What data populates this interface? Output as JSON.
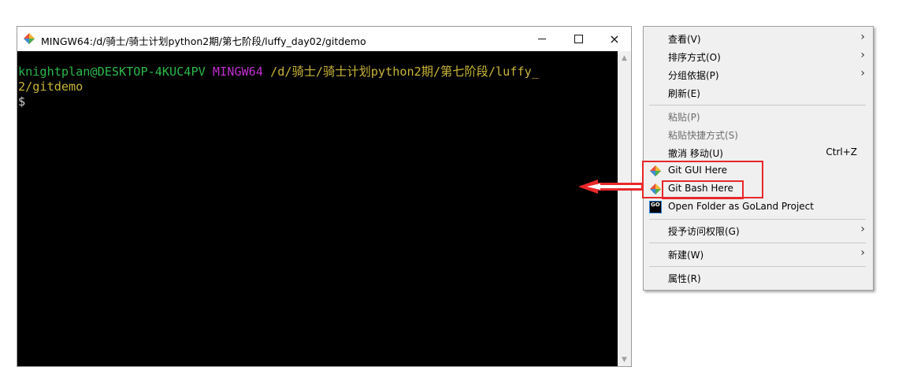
{
  "terminal": {
    "title": "MINGW64:/d/骑士/骑士计划python2期/第七阶段/luffy_day02/gitdemo",
    "controls": {
      "minimize": "minimize",
      "maximize": "maximize",
      "close": "×"
    },
    "lines": {
      "user_host": "knightplan@DESKTOP-4KUC4PV",
      "env": "MINGW64",
      "path_part1": "/d/骑士/骑士计划python2期/第七阶段/luffy_",
      "path_part2": "2/gitdemo",
      "prompt": "$"
    },
    "colors": {
      "user_host": "#2bb84b",
      "env": "#c02ed1",
      "path": "#c9b538",
      "prompt": "#d0d0d0"
    }
  },
  "context_menu": {
    "items": [
      {
        "label": "查看(V)",
        "submenu": true
      },
      {
        "label": "排序方式(O)",
        "submenu": true
      },
      {
        "label": "分组依据(P)",
        "submenu": true
      },
      {
        "label": "刷新(E)"
      },
      {
        "label": "粘贴(P)",
        "disabled": true
      },
      {
        "label": "粘贴快捷方式(S)",
        "disabled": true
      },
      {
        "label": "撤消 移动(U)",
        "shortcut": "Ctrl+Z"
      },
      {
        "label": "Git GUI Here",
        "icon": "git-icon"
      },
      {
        "label": "Git Bash Here",
        "icon": "git-icon"
      },
      {
        "label": "Open Folder as GoLand Project",
        "icon": "goland-icon",
        "icon_text": "GO"
      },
      {
        "label": "授予访问权限(G)",
        "submenu": true
      },
      {
        "label": "新建(W)",
        "submenu": true
      },
      {
        "label": "属性(R)"
      }
    ],
    "submenu_glyph": "›"
  },
  "annotation": {
    "highlight_color": "#e8282a",
    "arrow_direction": "left"
  }
}
